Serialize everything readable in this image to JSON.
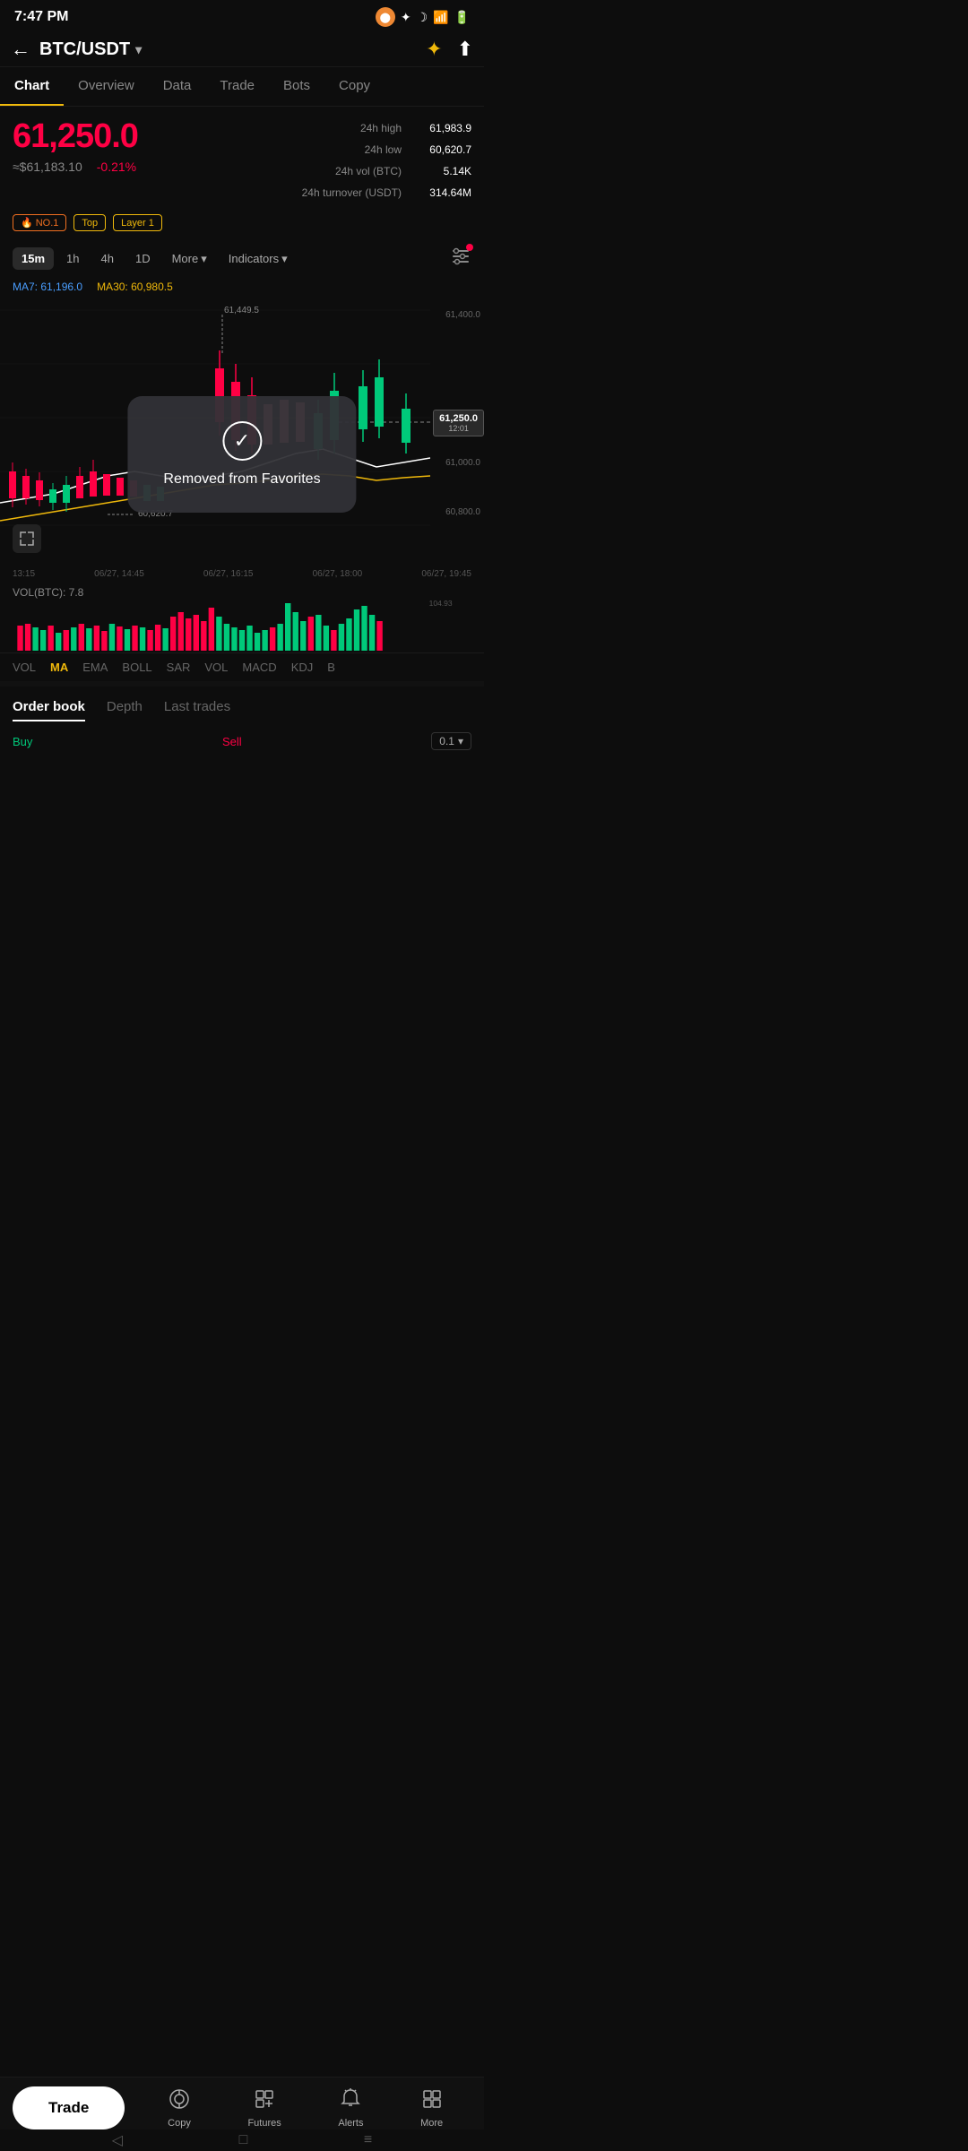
{
  "statusBar": {
    "time": "7:47 PM",
    "icons": [
      "video",
      "bluetooth",
      "moon",
      "wifi",
      "battery"
    ]
  },
  "header": {
    "pair": "BTC/USDT",
    "backLabel": "←",
    "favIcon": "★",
    "shareIcon": "⬆"
  },
  "tabs": [
    {
      "id": "chart",
      "label": "Chart",
      "active": true
    },
    {
      "id": "overview",
      "label": "Overview",
      "active": false
    },
    {
      "id": "data",
      "label": "Data",
      "active": false
    },
    {
      "id": "trade",
      "label": "Trade",
      "active": false
    },
    {
      "id": "bots",
      "label": "Bots",
      "active": false
    },
    {
      "id": "copy",
      "label": "Copy",
      "active": false
    }
  ],
  "price": {
    "main": "61,250.0",
    "usd": "≈$61,183.10",
    "change": "-0.21%",
    "stats": {
      "high_label": "24h high",
      "high_value": "61,983.9",
      "low_label": "24h low",
      "low_value": "60,620.7",
      "vol_btc_label": "24h vol (BTC)",
      "vol_btc_value": "5.14K",
      "turnover_label": "24h turnover (USDT)",
      "turnover_value": "314.64M"
    }
  },
  "tags": [
    {
      "icon": "🔥",
      "label": "NO.1"
    },
    {
      "label": "Top"
    },
    {
      "label": "Layer 1"
    }
  ],
  "timeframes": [
    {
      "label": "15m",
      "active": true
    },
    {
      "label": "1h",
      "active": false
    },
    {
      "label": "4h",
      "active": false
    },
    {
      "label": "1D",
      "active": false
    },
    {
      "label": "More",
      "active": false
    },
    {
      "label": "Indicators",
      "active": false
    }
  ],
  "ma": {
    "ma7_label": "MA7:",
    "ma7_value": "61,196.0",
    "ma30_label": "MA30:",
    "ma30_value": "60,980.5"
  },
  "chart": {
    "high_price_label": "61,449.5",
    "high_price_level": 61449.5,
    "current_price": "61,250.0",
    "current_time": "12:01",
    "low_price": "60,620.7",
    "price_levels": [
      {
        "value": "61,400.0",
        "y_pct": 5
      },
      {
        "value": "61,250.0",
        "y_pct": 42
      },
      {
        "value": "61,000.0",
        "y_pct": 60
      },
      {
        "value": "60,800.0",
        "y_pct": 78
      }
    ],
    "dashed_line_label": "60,620.7"
  },
  "notification": {
    "icon": "✓",
    "text": "Removed from Favorites"
  },
  "timeAxis": {
    "labels": [
      "13:15",
      "06/27, 14:45",
      "06/27, 16:15",
      "06/27, 18:00",
      "06/27, 19:45"
    ]
  },
  "volume": {
    "label": "VOL(BTC):",
    "value": "7.8",
    "vol_level": "104.93"
  },
  "indicatorTabs": [
    {
      "label": "VOL",
      "active": false
    },
    {
      "label": "MA",
      "active": true
    },
    {
      "label": "EMA",
      "active": false
    },
    {
      "label": "BOLL",
      "active": false
    },
    {
      "label": "SAR",
      "active": false
    },
    {
      "label": "VOL",
      "active": false
    },
    {
      "label": "MACD",
      "active": false
    },
    {
      "label": "KDJ",
      "active": false
    },
    {
      "label": "B",
      "active": false
    }
  ],
  "orderBook": {
    "tabs": [
      {
        "label": "Order book",
        "active": true
      },
      {
        "label": "Depth",
        "active": false
      },
      {
        "label": "Last trades",
        "active": false
      }
    ],
    "buy_label": "Buy",
    "sell_label": "Sell",
    "size_options": [
      "0.1"
    ],
    "selected_size": "0.1"
  },
  "bottomNav": {
    "trade_btn": "Trade",
    "actions": [
      {
        "icon": "◎",
        "label": "Copy"
      },
      {
        "icon": "📋",
        "label": "Futures"
      },
      {
        "icon": "🔔",
        "label": "Alerts"
      },
      {
        "icon": "⊞",
        "label": "More"
      }
    ]
  },
  "androidNav": {
    "back": "◁",
    "home": "□",
    "menu": "≡"
  }
}
